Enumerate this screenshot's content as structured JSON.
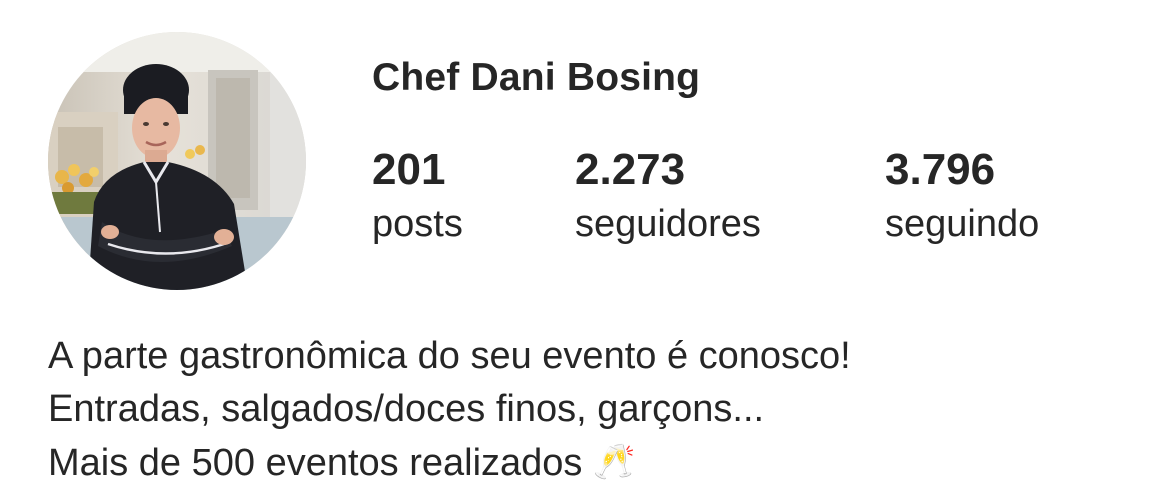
{
  "profile": {
    "username": "Chef Dani Bosing",
    "avatar_icon": "profile-photo-chef"
  },
  "stats": {
    "posts": {
      "value": "201",
      "label": "posts"
    },
    "followers": {
      "value": "2.273",
      "label": "seguidores"
    },
    "following": {
      "value": "3.796",
      "label": "seguindo"
    }
  },
  "bio": {
    "line1": "A parte gastronômica do seu evento é conosco!",
    "line2": "Entradas, salgados/doces finos, garçons...",
    "line3": "Mais de 500 eventos realizados",
    "line3_emoji": "🥂"
  },
  "colors": {
    "text": "#262626",
    "background": "#ffffff",
    "chef_jacket": "#1f2026"
  }
}
